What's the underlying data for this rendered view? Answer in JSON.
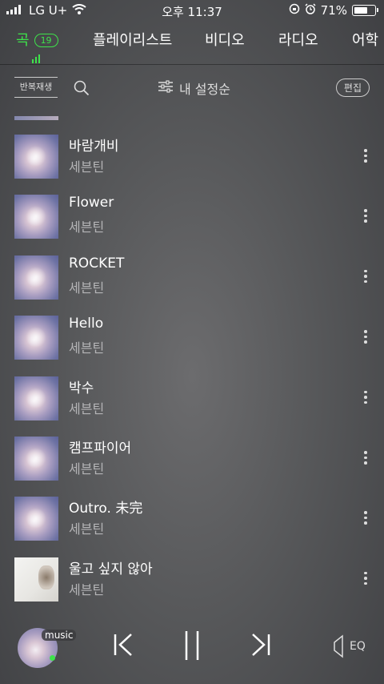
{
  "status": {
    "carrier": "LG U+",
    "time": "오후 11:37",
    "battery": "71%",
    "battery_level": 0.71
  },
  "tabs": [
    {
      "label": "곡",
      "count": "19",
      "active": true
    },
    {
      "label": "플레이리스트"
    },
    {
      "label": "비디오"
    },
    {
      "label": "라디오"
    },
    {
      "label": "어학"
    }
  ],
  "toolbar": {
    "repeat_label": "반복재생",
    "sort_label": "내 설정순",
    "edit_label": "편집"
  },
  "songs": [
    {
      "title": "바람개비",
      "artist": "세븐틴"
    },
    {
      "title": "Flower",
      "artist": "세븐틴"
    },
    {
      "title": "ROCKET",
      "artist": "세븐틴"
    },
    {
      "title": "Hello",
      "artist": "세븐틴"
    },
    {
      "title": "박수",
      "artist": "세븐틴"
    },
    {
      "title": "캠프파이어",
      "artist": "세븐틴"
    },
    {
      "title": "Outro. 未完",
      "artist": "세븐틴"
    },
    {
      "title": "울고 싶지 않아",
      "artist": "세븐틴"
    }
  ],
  "player": {
    "source_label": "music",
    "eq_label": "EQ"
  },
  "colors": {
    "accent": "#3ee34b"
  }
}
